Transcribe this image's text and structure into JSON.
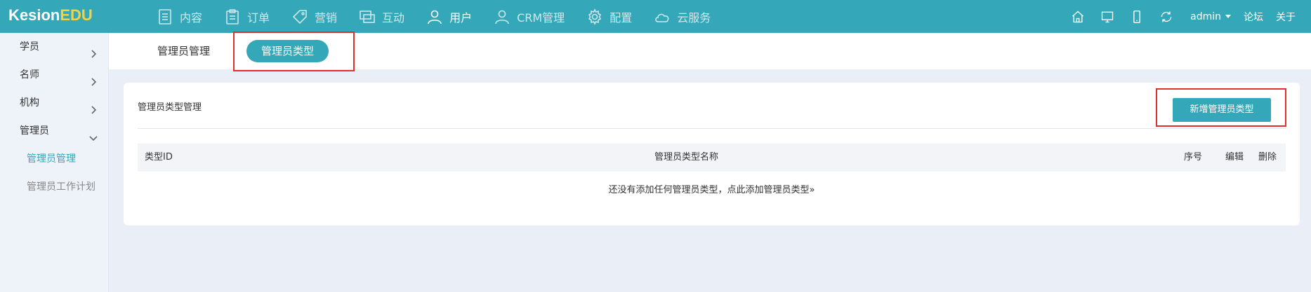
{
  "brand": {
    "part1": "Kesion",
    "part2": "EDU",
    "color_accent": "#f1d24a"
  },
  "theme": {
    "primary": "#34a8b8",
    "highlight": "#e0302d"
  },
  "nav": [
    {
      "label": "内容",
      "icon": "document-icon"
    },
    {
      "label": "订单",
      "icon": "clipboard-icon"
    },
    {
      "label": "营销",
      "icon": "tag-icon"
    },
    {
      "label": "互动",
      "icon": "chat-monitor-icon"
    },
    {
      "label": "用户",
      "icon": "user-icon",
      "active": true
    },
    {
      "label": "CRM管理",
      "icon": "crm-user-icon"
    },
    {
      "label": "配置",
      "icon": "gear-icon"
    },
    {
      "label": "云服务",
      "icon": "cloud-icon"
    }
  ],
  "tools": {
    "home": "home-icon",
    "desktop": "desktop-icon",
    "mobile": "mobile-icon",
    "refresh": "refresh-icon",
    "user": "admin",
    "forum": "论坛",
    "about": "关于"
  },
  "sidebar": {
    "items": [
      {
        "label": "学员"
      },
      {
        "label": "名师"
      },
      {
        "label": "机构"
      },
      {
        "label": "管理员"
      }
    ],
    "sub": [
      {
        "label": "管理员管理",
        "active": true
      },
      {
        "label": "管理员工作计划"
      }
    ]
  },
  "tabs": {
    "first": "管理员管理",
    "second": "管理员类型"
  },
  "panel": {
    "title": "管理员类型管理",
    "add_button": "新增管理员类型",
    "columns": [
      "类型ID",
      "管理员类型名称",
      "序号",
      "编辑",
      "删除"
    ],
    "empty": "还没有添加任何管理员类型，点此添加管理员类型»"
  }
}
